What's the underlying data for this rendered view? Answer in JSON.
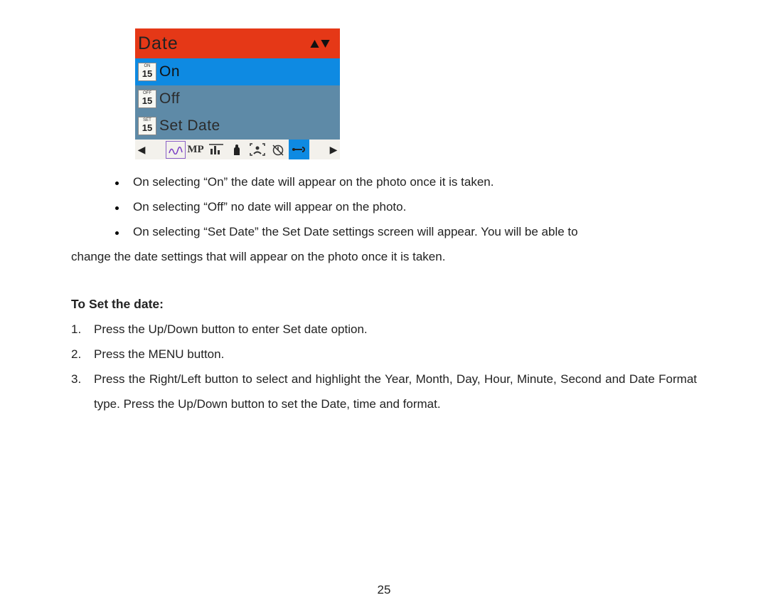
{
  "menu": {
    "title": "Date",
    "items": [
      {
        "icon_top": "ON",
        "icon_num": "15",
        "label": "On",
        "selected": true
      },
      {
        "icon_top": "OFF",
        "icon_num": "15",
        "label": "Off",
        "selected": false
      },
      {
        "icon_top": "SET",
        "icon_num": "15",
        "label": "Set  Date",
        "selected": false
      }
    ],
    "bottom_bar": {
      "left_arrow": "◀",
      "right_arrow": "▶",
      "icons": [
        "wave",
        "MP",
        "bars",
        "hand",
        "face",
        "timer",
        "wrench"
      ]
    }
  },
  "bullets": [
    "On selecting “On” the date will appear on the photo once it is taken.",
    "On selecting “Off” no date will appear on the photo.",
    "On selecting “Set Date” the Set Date settings screen will appear. You will be able to"
  ],
  "bullet3_cont": "change the date settings that will appear on the photo once it is taken.",
  "heading": "To Set the date:",
  "steps": [
    {
      "n": "1.",
      "t": "Press the Up/Down button to enter Set date option."
    },
    {
      "n": "2.",
      "t": "Press the MENU button."
    },
    {
      "n": "3.",
      "t": "Press the Right/Left button to select and highlight the Year, Month, Day, Hour, Minute, Second and Date Format type. Press the Up/Down button to set the Date, time and format."
    }
  ],
  "page_number": "25"
}
